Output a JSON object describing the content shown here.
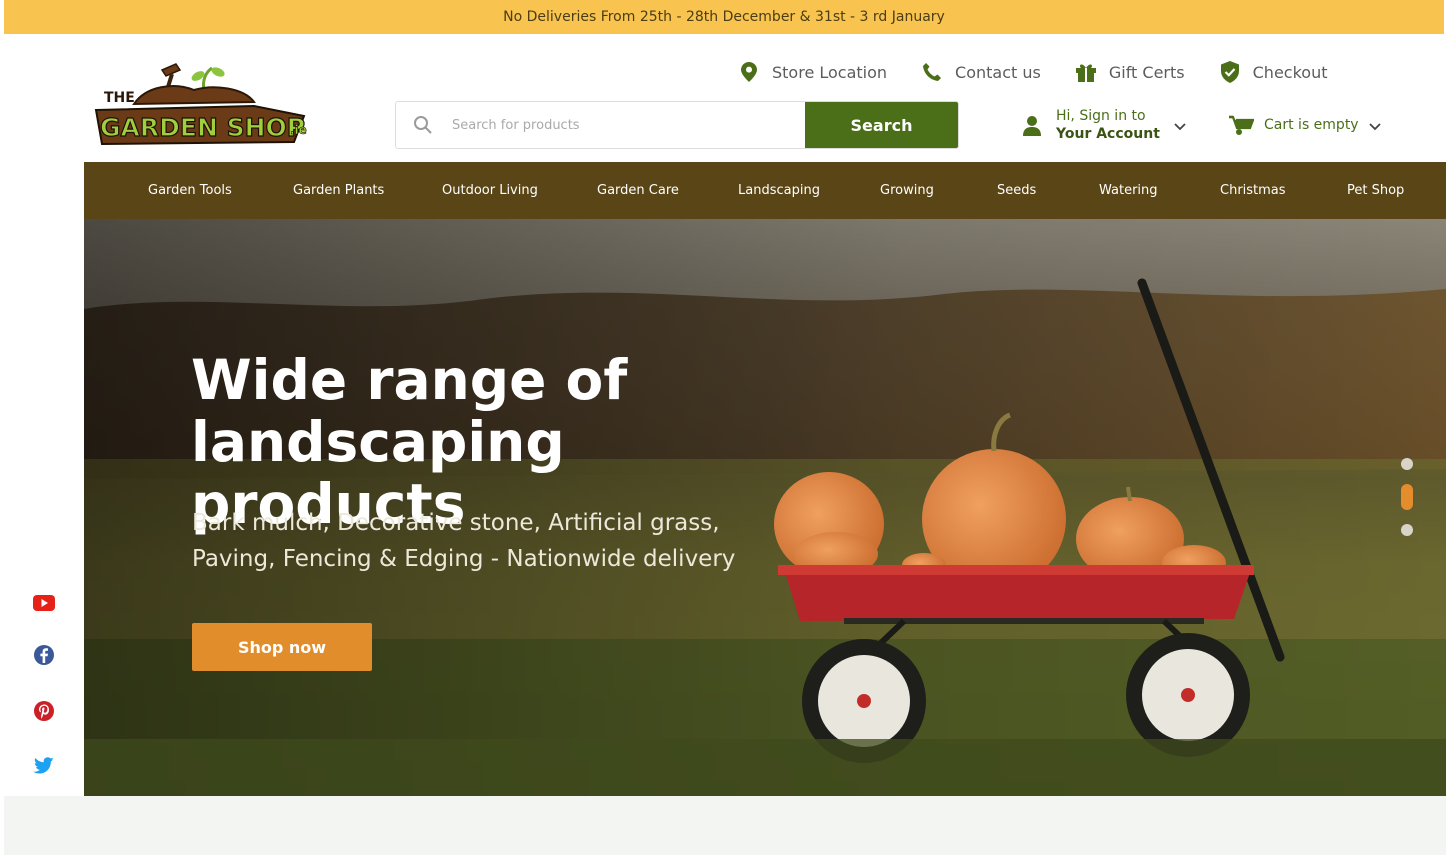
{
  "announcement": "No Deliveries From 25th - 28th December & 31st - 3 rd January",
  "logo": {
    "text_line1": "THE",
    "text_line2": "GARDEN SHOP",
    "suffix": ".ie"
  },
  "top_links": [
    {
      "label": "Store Location",
      "icon": "map-pin-icon"
    },
    {
      "label": "Contact us",
      "icon": "phone-icon"
    },
    {
      "label": "Gift Certs",
      "icon": "gift-icon"
    },
    {
      "label": "Checkout",
      "icon": "shield-check-icon"
    }
  ],
  "search": {
    "placeholder": "Search for products",
    "button_label": "Search"
  },
  "account": {
    "line1": "Hi, Sign in to",
    "line2": "Your Account"
  },
  "cart": {
    "label": "Cart is empty"
  },
  "nav": [
    "Garden Tools",
    "Garden Plants",
    "Outdoor Living",
    "Garden Care",
    "Landscaping",
    "Growing",
    "Seeds",
    "Watering",
    "Christmas",
    "Pet Shop"
  ],
  "hero": {
    "title_line1": "Wide range of",
    "title_line2": "landscaping products",
    "subtitle_line1": "Bark mulch, Decorative stone, Artificial grass,",
    "subtitle_line2": "Paving, Fencing & Edging - Nationwide delivery",
    "cta": "Shop now",
    "slide_count": 3,
    "active_slide": 2
  },
  "social": [
    "youtube-icon",
    "facebook-icon",
    "pinterest-icon",
    "twitter-icon"
  ],
  "colors": {
    "announce_bg": "#f8c34f",
    "brand_green": "#4b6f18",
    "nav_brown": "#5a4516",
    "cta_orange": "#e28d2c"
  }
}
